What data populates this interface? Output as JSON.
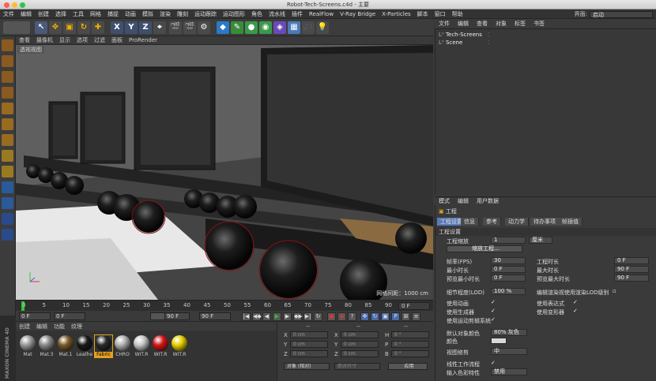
{
  "window": {
    "title": "Robot-Tech-Screens.c4d - 主要"
  },
  "menu": [
    "文件",
    "编辑",
    "创建",
    "选择",
    "工具",
    "网格",
    "捕捉",
    "动画",
    "模拟",
    "渲染",
    "雕刻",
    "运动跟踪",
    "运动图形",
    "角色",
    "流水线",
    "插件",
    "RealFlow",
    "V-Ray Bridge",
    "X-Particles",
    "脚本",
    "窗口",
    "帮助"
  ],
  "interface": {
    "label": "界面:",
    "value": "启动"
  },
  "toolbar": {
    "x": "X",
    "y": "Y",
    "z": "Z"
  },
  "viewport": {
    "menu": [
      "查看",
      "摄像机",
      "显示",
      "选项",
      "过滤",
      "面板",
      "ProRender"
    ],
    "label": "透视视图",
    "grid_info": "网格间距：1000 cm"
  },
  "timeline": {
    "ticks": [
      "0",
      "5",
      "10",
      "15",
      "20",
      "25",
      "30",
      "35",
      "40",
      "45",
      "50",
      "55",
      "60",
      "65",
      "70",
      "75",
      "80",
      "85",
      "90"
    ],
    "frame_out": "0 F",
    "current": 0
  },
  "transport": {
    "start": "0 F",
    "start2": "0 F",
    "end": "90 F",
    "end2": "90 F"
  },
  "materials": {
    "menu": [
      "创建",
      "编辑",
      "功能",
      "纹理"
    ],
    "items": [
      {
        "name": "Mat",
        "color": "#9a9a9a"
      },
      {
        "name": "Mat.3",
        "color": "#8a8a8a"
      },
      {
        "name": "Mat.1",
        "color": "#7a5a2a"
      },
      {
        "name": "Leathe",
        "color": "#1a1a1a"
      },
      {
        "name": "Fabric",
        "color": "#2a2a2a"
      },
      {
        "name": "CHRO",
        "color": "#b0b0b0"
      },
      {
        "name": "WIT.R",
        "color": "#c8c8c8"
      },
      {
        "name": "WIT.R",
        "color": "#d41818"
      },
      {
        "name": "WIT.R",
        "color": "#e8d000"
      }
    ]
  },
  "maxon": "MAXON CINEMA 4D",
  "coords": {
    "header": "--",
    "rows": [
      {
        "a": "X",
        "av": "0 cm",
        "b": "X",
        "bv": "0 cm",
        "c": "H",
        "cv": "0 °"
      },
      {
        "a": "Y",
        "av": "0 cm",
        "b": "Y",
        "bv": "0 cm",
        "c": "P",
        "cv": "0 °"
      },
      {
        "a": "Z",
        "av": "0 cm",
        "b": "Z",
        "bv": "0 cm",
        "c": "B",
        "cv": "0 °"
      }
    ],
    "mode": "对象 (相对)",
    "size": "绝对尺寸",
    "apply": "应用"
  },
  "objects": {
    "menu": [
      "文件",
      "编辑",
      "查看",
      "对象",
      "标签",
      "书签"
    ],
    "items": [
      "Tech-Screens",
      "Scene"
    ]
  },
  "attributes": {
    "menu": [
      "模式",
      "编辑",
      "用户数据"
    ],
    "title": "工程",
    "tabs": [
      "工程设置",
      "信息",
      "参考",
      "动力学",
      "待办事项",
      "帧插值"
    ],
    "section": "工程设置",
    "scale_label": "工程缩放",
    "scale_value": "1",
    "scale_unit": "厘米",
    "scale_button": "缩放工程...",
    "fps_label": "帧率(FPS)",
    "fps_value": "30",
    "duration_label": "工程时长",
    "duration_value": "0 F",
    "min_label": "最小时长",
    "min_value": "0 F",
    "max_label": "最大时长",
    "max_value": "90 F",
    "pmin_label": "预览最小时长",
    "pmin_value": "0 F",
    "pmax_label": "预览最大时长",
    "pmax_value": "90 F",
    "lod_label": "细节程度(LOD)",
    "lod_value": "100 %",
    "lod_render": "编辑渲染视使用渲染LOD级别",
    "anim_label": "使用动画",
    "expr_label": "使用表达式",
    "gen_label": "使用生成器",
    "deform_label": "使用变形器",
    "motion_label": "使用运动剪辑系统",
    "objcolor_label": "默认对象颜色",
    "objcolor_value": "80% 灰色",
    "color_label": "颜色",
    "clip_label": "视图修剪",
    "clip_value": "中",
    "linear_label": "线性工作流程",
    "input_label": "输入色彩特性",
    "input_value": "禁用"
  }
}
